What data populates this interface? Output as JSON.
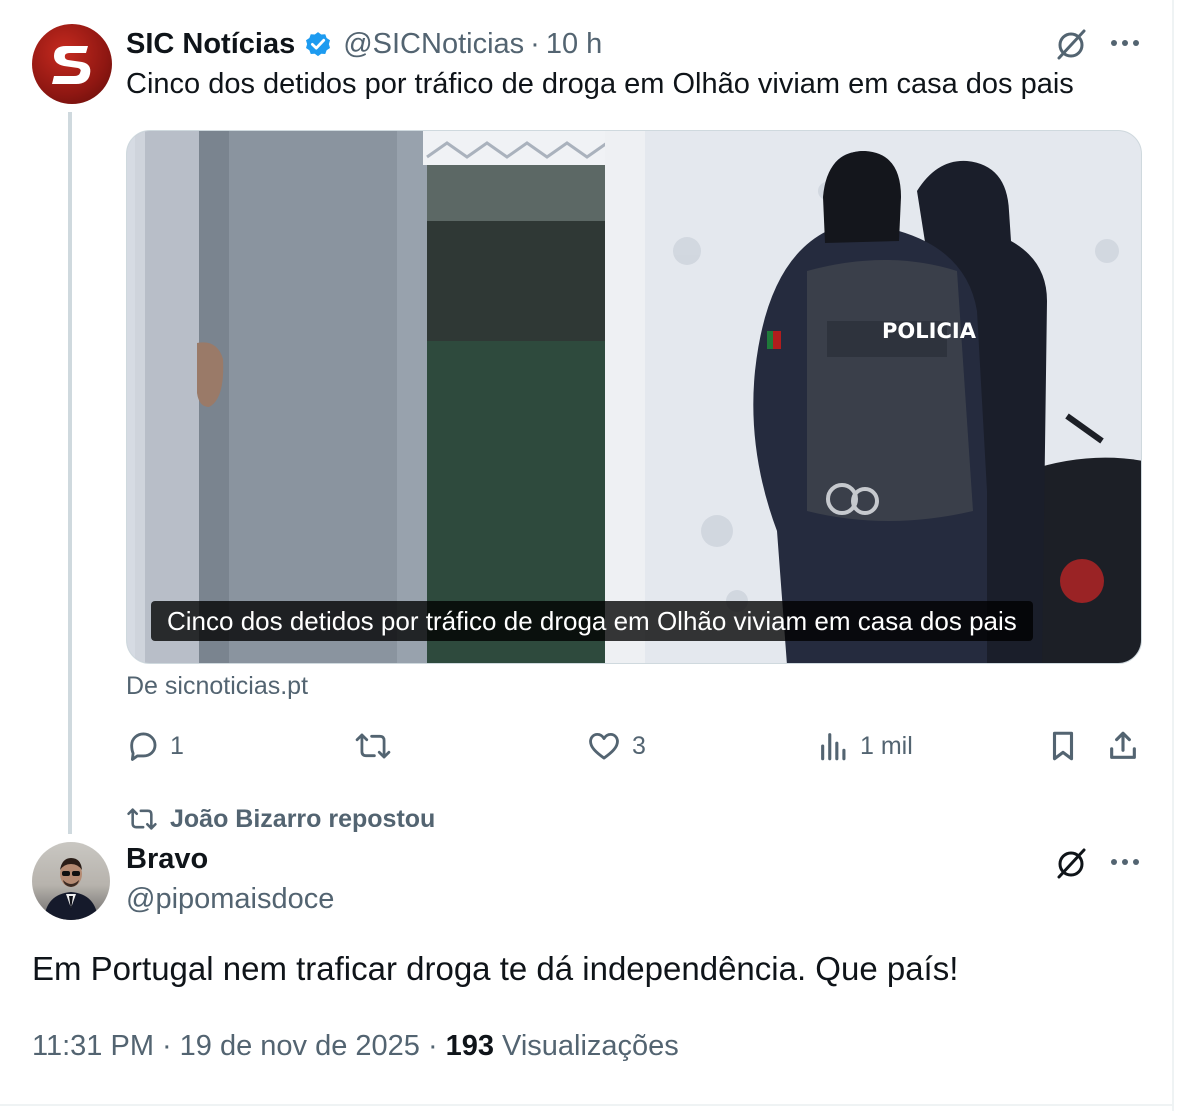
{
  "tweet": {
    "author": {
      "name": "SIC Notícias",
      "handle": "@SICNoticias",
      "verified": true,
      "avatar_icon": "sic-logo"
    },
    "time": "10 h",
    "separator": "·",
    "text": "Cinco dos detidos por tráfico de droga em Olhão viviam em casa dos pais",
    "media": {
      "caption": "Cinco dos detidos por tráfico de droga em Olhão viviam em casa dos pais",
      "vest_text": "POLICIA"
    },
    "source": "De sicnoticias.pt",
    "actions": {
      "reply_count": "1",
      "repost_count": "",
      "like_count": "3",
      "views_count": "1 mil"
    }
  },
  "repost_label": "João Bizarro repostou",
  "quote": {
    "author": {
      "name": "Bravo",
      "handle": "@pipomaisdoce"
    },
    "text": "Em Portugal nem traficar droga te dá independência. Que país!",
    "meta": {
      "time": "11:31 PM",
      "date": "19 de nov de 2025",
      "separator": "·",
      "views": "193",
      "views_label": "Visualizações"
    }
  },
  "colors": {
    "text_primary": "#0f1419",
    "text_secondary": "#536471",
    "verified_blue": "#1d9bf0",
    "border": "#cfd9de",
    "sic_red": "#b3201a"
  }
}
